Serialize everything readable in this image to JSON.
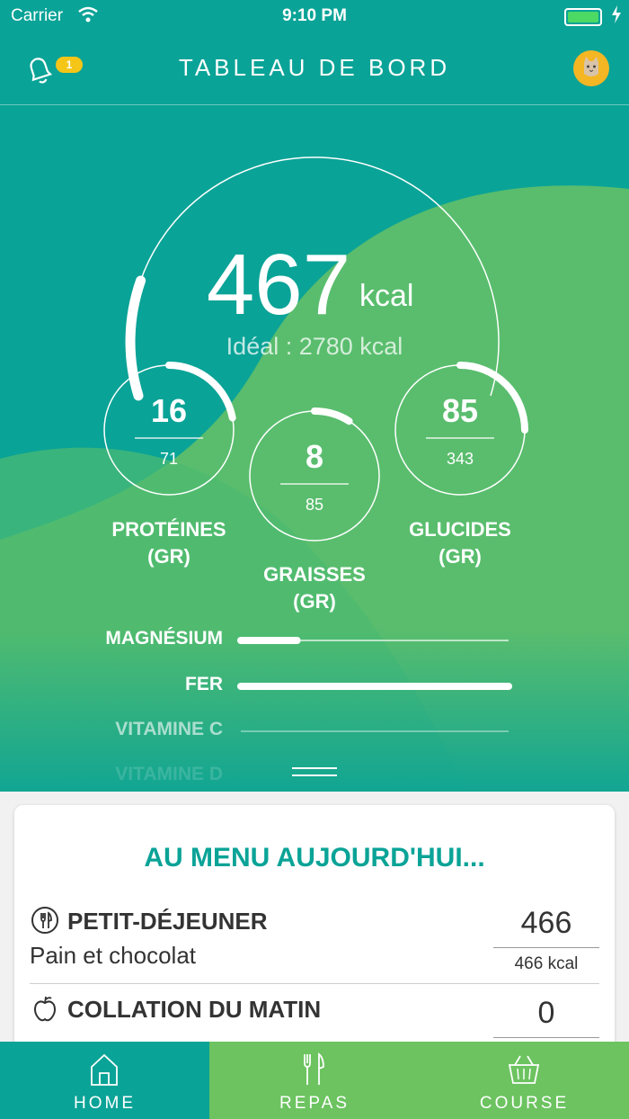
{
  "status_bar": {
    "carrier": "Carrier",
    "time": "9:10 PM"
  },
  "header": {
    "title": "TABLEAU DE BORD",
    "notification_count": "1"
  },
  "calories": {
    "value": "467",
    "unit": "kcal",
    "ideal": "Idéal : 2780 kcal",
    "progress": 0.17
  },
  "macros": [
    {
      "value": "16",
      "target": "71",
      "label_line1": "PROTÉINES",
      "label_line2": "(GR)",
      "progress": 0.22
    },
    {
      "value": "8",
      "target": "85",
      "label_line1": "GRAISSES",
      "label_line2": "(GR)",
      "progress": 0.09
    },
    {
      "value": "85",
      "target": "343",
      "label_line1": "GLUCIDES",
      "label_line2": "(GR)",
      "progress": 0.25
    }
  ],
  "minerals": [
    {
      "label": "MAGNÉSIUM",
      "progress": 0.21
    },
    {
      "label": "FER",
      "progress": 1.0
    },
    {
      "label": "VITAMINE C",
      "progress": 0.0
    },
    {
      "label": "VITAMINE D",
      "progress": 0.0
    }
  ],
  "menu": {
    "title": "AU MENU AUJOURD'HUI...",
    "meals": [
      {
        "name": "PETIT-DÉJEUNER",
        "description": "Pain et chocolat",
        "value": "466",
        "kcal": "466 kcal",
        "icon": "utensils-icon"
      },
      {
        "name": "COLLATION DU MATIN",
        "description": "",
        "value": "0",
        "kcal": "",
        "icon": "apple-icon"
      }
    ]
  },
  "tabs": [
    {
      "label": "HOME",
      "icon": "home-icon"
    },
    {
      "label": "REPAS",
      "icon": "fork-knife-icon"
    },
    {
      "label": "COURSE",
      "icon": "basket-icon"
    }
  ],
  "colors": {
    "teal": "#0aa397",
    "green": "#6cc360",
    "gold": "#f5c518"
  }
}
